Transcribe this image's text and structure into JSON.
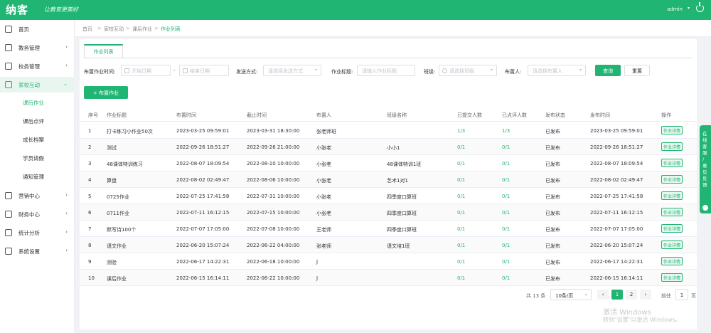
{
  "header": {
    "logo": "纳客",
    "slogan": "让教育更美好",
    "user": "admin",
    "brand_color": "#21b573"
  },
  "sidebar": {
    "items": [
      {
        "label": "首页",
        "icon": "home-icon"
      },
      {
        "label": "教务管理",
        "icon": "doc-icon"
      },
      {
        "label": "校务管理",
        "icon": "book-icon"
      },
      {
        "label": "家校互动",
        "icon": "chat-icon"
      },
      {
        "label": "营销中心",
        "icon": "gift-icon"
      },
      {
        "label": "财务中心",
        "icon": "money-icon"
      },
      {
        "label": "统计分析",
        "icon": "chart-icon"
      },
      {
        "label": "系统设置",
        "icon": "gear-icon"
      }
    ],
    "sub_items": [
      "课后作业",
      "课后点评",
      "成长档案",
      "学员请假",
      "通知管理"
    ]
  },
  "breadcrumb": [
    "首页",
    "家校互动",
    "课后作业",
    "作业列表"
  ],
  "tab": "作业列表",
  "filters": {
    "publish_time_label": "布置作业时间:",
    "start_placeholder": "开始日期",
    "end_placeholder": "结束日期",
    "dash": "-",
    "send_mode_label": "发送方式:",
    "send_mode_placeholder": "请选择发送方式",
    "title_label": "作业标题:",
    "title_placeholder": "请输入作业标题",
    "class_label": "班级:",
    "class_placeholder": "请选择班级",
    "teacher_label": "布置人:",
    "teacher_placeholder": "请选择布置人",
    "search_button": "查询",
    "reset_button": "重置"
  },
  "add_button": "+ 布置作业",
  "table": {
    "headers": [
      "序号",
      "作业标题",
      "布置时间",
      "截止时间",
      "布置人",
      "班级名称",
      "已提交人数",
      "已点评人数",
      "发布状态",
      "发布时间",
      "操作"
    ],
    "rows": [
      [
        "1",
        "打卡练习小作业50次",
        "2023-03-25 09:59:01",
        "2023-03-31 18:30:00",
        "张老师班",
        "",
        "1/3",
        "1/3",
        "已发布",
        "2023-03-25 09:59:01",
        "作业详情"
      ],
      [
        "2",
        "测试",
        "2022-09-26 18:51:27",
        "2022-09-26 21:00:00",
        "小张老",
        "小小1",
        "0/1",
        "0/1",
        "已发布",
        "2022-09-26 18:51:27",
        "作业详情"
      ],
      [
        "3",
        "48课体特训练习",
        "2022-08-07 18:09:54",
        "2022-08-10 10:00:00",
        "小张老",
        "48课体特训1班",
        "0/1",
        "0/1",
        "已发布",
        "2022-08-07 18:09:54",
        "作业详情"
      ],
      [
        "4",
        "算盘",
        "2022-08-02 02:49:47",
        "2022-08-06 10:00:00",
        "小张老",
        "艺术1对1",
        "0/1",
        "0/1",
        "已发布",
        "2022-08-02 02:49:47",
        "作业详情"
      ],
      [
        "5",
        "0725作业",
        "2022-07-25 17:41:58",
        "2022-07-31 10:00:00",
        "小张老",
        "四季度口算班",
        "0/1",
        "0/1",
        "已发布",
        "2022-07-25 17:41:58",
        "作业详情"
      ],
      [
        "6",
        "0711作业",
        "2022-07-11 16:12:15",
        "2022-07-15 10:00:00",
        "小张老",
        "四季度口算班",
        "0/1",
        "0/1",
        "已发布",
        "2022-07-11 16:12:15",
        "作业详情"
      ],
      [
        "7",
        "默写诗100个",
        "2022-07-07 17:05:00",
        "2022-07-08 10:00:00",
        "王老师",
        "四季度口算班",
        "0/1",
        "0/1",
        "已发布",
        "2022-07-07 17:05:00",
        "作业详情"
      ],
      [
        "8",
        "语文作业",
        "2022-06-20 15:07:24",
        "2022-06-22 04:00:00",
        "张老师",
        "语文培1班",
        "0/1",
        "0/1",
        "已发布",
        "2022-06-20 15:07:24",
        "作业详情"
      ],
      [
        "9",
        "测验",
        "2022-06-17 14:22:31",
        "2022-06-18 10:00:00",
        "J",
        "",
        "0/1",
        "0/1",
        "已发布",
        "2022-06-17 14:22:31",
        "作业详情"
      ],
      [
        "10",
        "课后作业",
        "2022-06-15 16:14:11",
        "2022-06-22 10:00:00",
        "J",
        "",
        "0/1",
        "0/1",
        "已发布",
        "2022-06-15 16:14:11",
        "作业详情"
      ]
    ]
  },
  "pagination": {
    "total": "共 13 条",
    "page_size": "10条/页",
    "prev": "‹",
    "pages": [
      "1",
      "2"
    ],
    "next": "›",
    "goto_label": "前往",
    "goto_value": "1",
    "page_unit": "页"
  },
  "side_tab": "在线客服 / 意见反馈",
  "watermark": {
    "line1": "激活 Windows",
    "line2": "转到\"设置\"以激活 Windows。"
  }
}
